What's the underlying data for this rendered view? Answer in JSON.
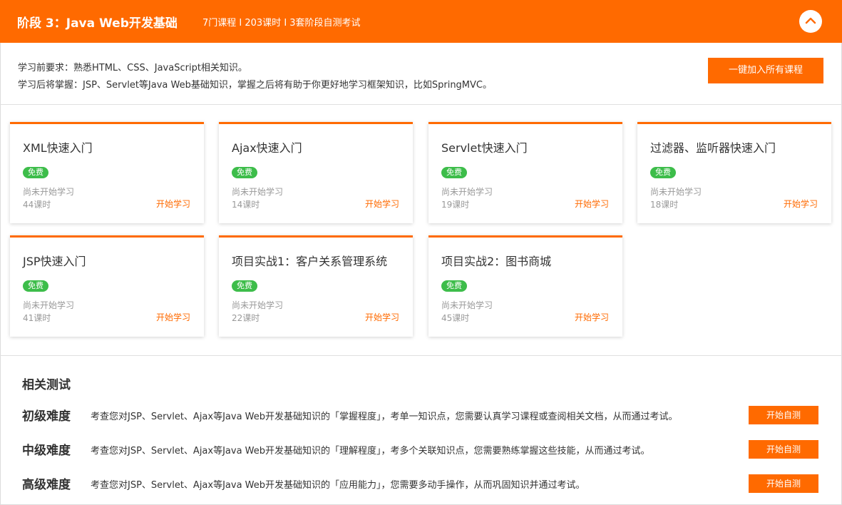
{
  "header": {
    "title": "阶段 3：Java Web开发基础",
    "meta": "7门课程 I 203课时 I 3套阶段自测考试",
    "collapse_icon": "chevron-up-icon"
  },
  "intro": {
    "prerequisite": "学习前要求：熟悉HTML、CSS、JavaScript相关知识。",
    "outcome": "学习后将掌握：JSP、Servlet等Java Web基础知识，掌握之后将有助于你更好地学习框架知识，比如SpringMVC。",
    "join_all_label": "一键加入所有课程"
  },
  "courses": [
    {
      "name": "XML快速入门",
      "badge": "免费",
      "status": "尚未开始学习",
      "hours": "44课时",
      "action": "开始学习"
    },
    {
      "name": "Ajax快速入门",
      "badge": "免费",
      "status": "尚未开始学习",
      "hours": "14课时",
      "action": "开始学习"
    },
    {
      "name": "Servlet快速入门",
      "badge": "免费",
      "status": "尚未开始学习",
      "hours": "19课时",
      "action": "开始学习"
    },
    {
      "name": "过滤器、监听器快速入门",
      "badge": "免费",
      "status": "尚未开始学习",
      "hours": "18课时",
      "action": "开始学习"
    },
    {
      "name": "JSP快速入门",
      "badge": "免费",
      "status": "尚未开始学习",
      "hours": "41课时",
      "action": "开始学习"
    },
    {
      "name": "项目实战1：客户关系管理系统",
      "badge": "免费",
      "status": "尚未开始学习",
      "hours": "22课时",
      "action": "开始学习"
    },
    {
      "name": "项目实战2：图书商城",
      "badge": "免费",
      "status": "尚未开始学习",
      "hours": "45课时",
      "action": "开始学习"
    }
  ],
  "tests": {
    "heading": "相关测试",
    "items": [
      {
        "level": "初级难度",
        "description": "考查您对JSP、Servlet、Ajax等Java Web开发基础知识的「掌握程度」，考单一知识点，您需要认真学习课程或查阅相关文档，从而通过考试。",
        "action": "开始自测"
      },
      {
        "level": "中级难度",
        "description": "考查您对JSP、Servlet、Ajax等Java Web开发基础知识的「理解程度」，考多个关联知识点，您需要熟练掌握这些技能，从而通过考试。",
        "action": "开始自测"
      },
      {
        "level": "高级难度",
        "description": "考查您对JSP、Servlet、Ajax等Java Web开发基础知识的「应用能力」，您需要多动手操作，从而巩固知识并通过考试。",
        "action": "开始自测"
      }
    ]
  },
  "colors": {
    "accent": "#ff6a00",
    "free_badge": "#3dbd4a"
  }
}
